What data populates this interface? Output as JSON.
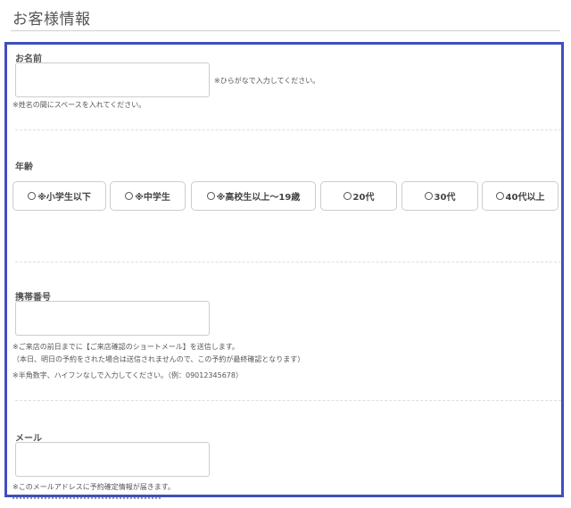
{
  "page_title": "お客様情報",
  "name_section": {
    "label": "お名前",
    "side_note": "※ひらがなで入力してください。",
    "note": "※姓名の間にスペースを入れてください。",
    "value": ""
  },
  "age_section": {
    "label": "年齢",
    "options": [
      "※小学生以下",
      "※中学生",
      "※高校生以上〜19歳",
      "20代",
      "30代",
      "40代以上"
    ]
  },
  "phone_section": {
    "label": "携帯番号",
    "note1": "※ご来店の前日までに【ご来店確認のショートメール】を送信します。",
    "note2": "（本日、明日の予約をされた場合は送信されませんので、この予約が最終確認となります）",
    "note3": "※半角数字、ハイフンなしで入力してください。（例：09012345678）",
    "value": ""
  },
  "mail_section": {
    "label": "メール",
    "note": "※このメールアドレスに予約確定情報が届きます。",
    "value": ""
  },
  "colors": {
    "frame_border": "#3f4fbf",
    "input_border": "#cccccc"
  }
}
